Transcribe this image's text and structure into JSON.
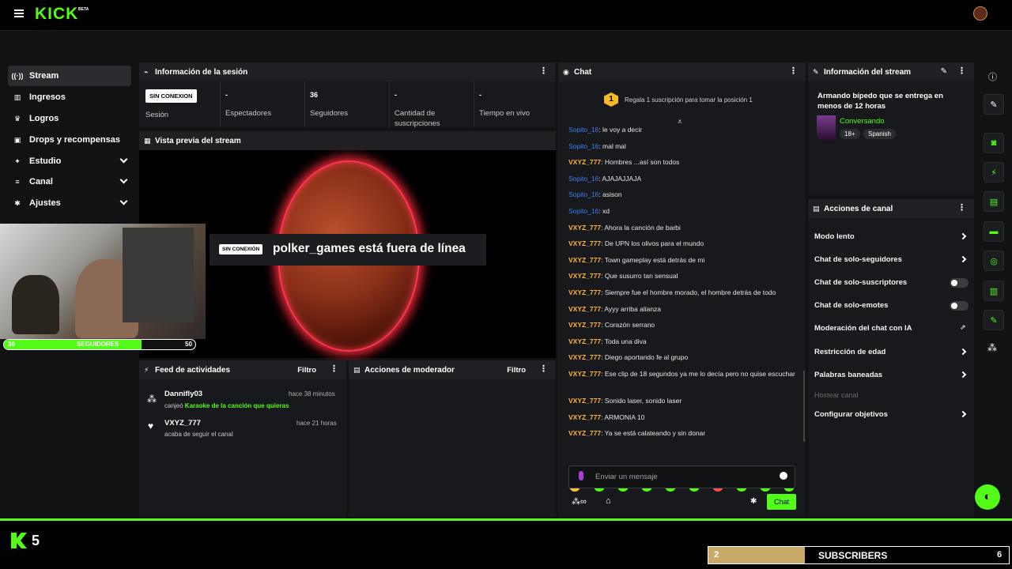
{
  "header": {
    "logo": "KICK",
    "beta": "BETA"
  },
  "sidebar": {
    "items": [
      {
        "label": "Stream",
        "icon": "broadcast-icon",
        "glyph": "((·))"
      },
      {
        "label": "Ingresos",
        "icon": "chart-icon",
        "glyph": "▥"
      },
      {
        "label": "Logros",
        "icon": "trophy-icon",
        "glyph": "♛"
      },
      {
        "label": "Drops y recompensas",
        "icon": "gift-icon",
        "glyph": "▣"
      },
      {
        "label": "Estudio",
        "icon": "studio-icon",
        "glyph": "✦"
      },
      {
        "label": "Canal",
        "icon": "channel-icon",
        "glyph": "≡"
      },
      {
        "label": "Ajustes",
        "icon": "gear-icon",
        "glyph": "✱"
      }
    ]
  },
  "session": {
    "title": "Información de la sesión",
    "status_badge": "SIN CONEXION",
    "status_label": "Sesión",
    "stats": [
      {
        "value": "-",
        "label": "Espectadores"
      },
      {
        "value": "36",
        "label": "Seguidores"
      },
      {
        "value": "-",
        "label": "Cantidad de suscripciones"
      },
      {
        "value": "-",
        "label": "Tiempo en vivo"
      }
    ]
  },
  "preview": {
    "title": "Vista previa del stream",
    "offline_badge": "SIN CONEXIÓN",
    "offline_text": "polker_games está fuera de línea"
  },
  "overlay": {
    "followers_current": "36",
    "followers_label": "SEGUIDORES",
    "followers_goal": "50",
    "followers_progress": 0.72,
    "brand_count": "5",
    "subs_value": "2",
    "subs_label": "SUBSCRIBERS",
    "subs_goal": "6"
  },
  "activity": {
    "title": "Feed de actividades",
    "filter": "Filtro",
    "items": [
      {
        "user": "Dannifly03",
        "time": "hace 38 minutos",
        "prefix": "canjeó ",
        "detail": "Karaoke de la canción que quieras"
      },
      {
        "user": "VXYZ_777",
        "time": "hace 21 horas",
        "prefix": "acaba de seguir el canal",
        "detail": ""
      }
    ]
  },
  "mod": {
    "title": "Acciones de moderador",
    "filter": "Filtro"
  },
  "chat": {
    "title": "Chat",
    "gift_rank": "1",
    "gift_text": "Regala 1 suscripción para tomar la posición 1",
    "messages": [
      {
        "user": "Sopito_16",
        "text": ": le voy a decir",
        "color": "blue"
      },
      {
        "user": "Sopito_16",
        "text": ": mal mal",
        "color": "blue"
      },
      {
        "user": "VXYZ_777",
        "text": ": Hombres ...así son todos",
        "color": "gold"
      },
      {
        "user": "Sopito_16",
        "text": ": AJAJAJJAJA",
        "color": "blue"
      },
      {
        "user": "Sopito_16",
        "text": ": asison",
        "color": "blue"
      },
      {
        "user": "Sopito_16",
        "text": ": xd",
        "color": "blue"
      },
      {
        "user": "VXYZ_777",
        "text": ": Ahora la canción de barbi",
        "color": "gold"
      },
      {
        "user": "VXYZ_777",
        "text": ": De UPN los olivos para el mundo",
        "color": "gold"
      },
      {
        "user": "VXYZ_777",
        "text": ": Town gameplay está detrás de mi",
        "color": "gold"
      },
      {
        "user": "VXYZ_777",
        "text": ": Que susurro tan sensual",
        "color": "gold"
      },
      {
        "user": "VXYZ_777",
        "text": ": Siempre fue el hombre morado, el hombre detrás de todo",
        "color": "gold"
      },
      {
        "user": "VXYZ_777",
        "text": ": Ayyy arriba alianza",
        "color": "gold"
      },
      {
        "user": "VXYZ_777",
        "text": ": Corazón serrano",
        "color": "gold"
      },
      {
        "user": "VXYZ_777",
        "text": ": Toda una diva",
        "color": "gold"
      },
      {
        "user": "VXYZ_777",
        "text": ": Diego aportando fe al grupo",
        "color": "gold"
      },
      {
        "user": "VXYZ_777",
        "text": ": Ese clip de 18 segundos ya me lo decía pero no quise escuchar",
        "color": "gold"
      },
      {
        "user": "VXYZ_777",
        "text": ": Sonido laser, sonido laser",
        "color": "gold"
      },
      {
        "user": "VXYZ_777",
        "text": ": ARMONIA 10",
        "color": "gold"
      },
      {
        "user": "VXYZ_777",
        "text": ": Ya se está calateando y sin donar",
        "color": "gold"
      }
    ],
    "input_placeholder": "Enviar un mensaje",
    "send_label": "Chat"
  },
  "stream_info": {
    "title": "Información del stream",
    "stream_title": "Armando bípedo que se entrega en menos de 12 horas",
    "category": "Conversando",
    "tags": [
      "18+",
      "Spanish"
    ]
  },
  "channel_actions": {
    "title": "Acciones de canal",
    "items": [
      {
        "label": "Modo lento",
        "control": "chevron"
      },
      {
        "label": "Chat de solo-seguidores",
        "control": "chevron"
      },
      {
        "label": "Chat de solo-suscriptores",
        "control": "toggle"
      },
      {
        "label": "Chat de solo-emotes",
        "control": "toggle"
      },
      {
        "label": "Moderación del chat con IA",
        "control": "external"
      },
      {
        "label": "Restricción de edad",
        "control": "chevron"
      },
      {
        "label": "Palabras baneadas",
        "control": "chevron"
      },
      {
        "label": "Hostear canal",
        "control": "disabled"
      },
      {
        "label": "Configurar objetivos",
        "control": "chevron"
      }
    ]
  },
  "colors": {
    "brand": "#53fc18",
    "panel": "#18191c",
    "gold": "#ffb43b",
    "blue": "#3b82f6"
  }
}
